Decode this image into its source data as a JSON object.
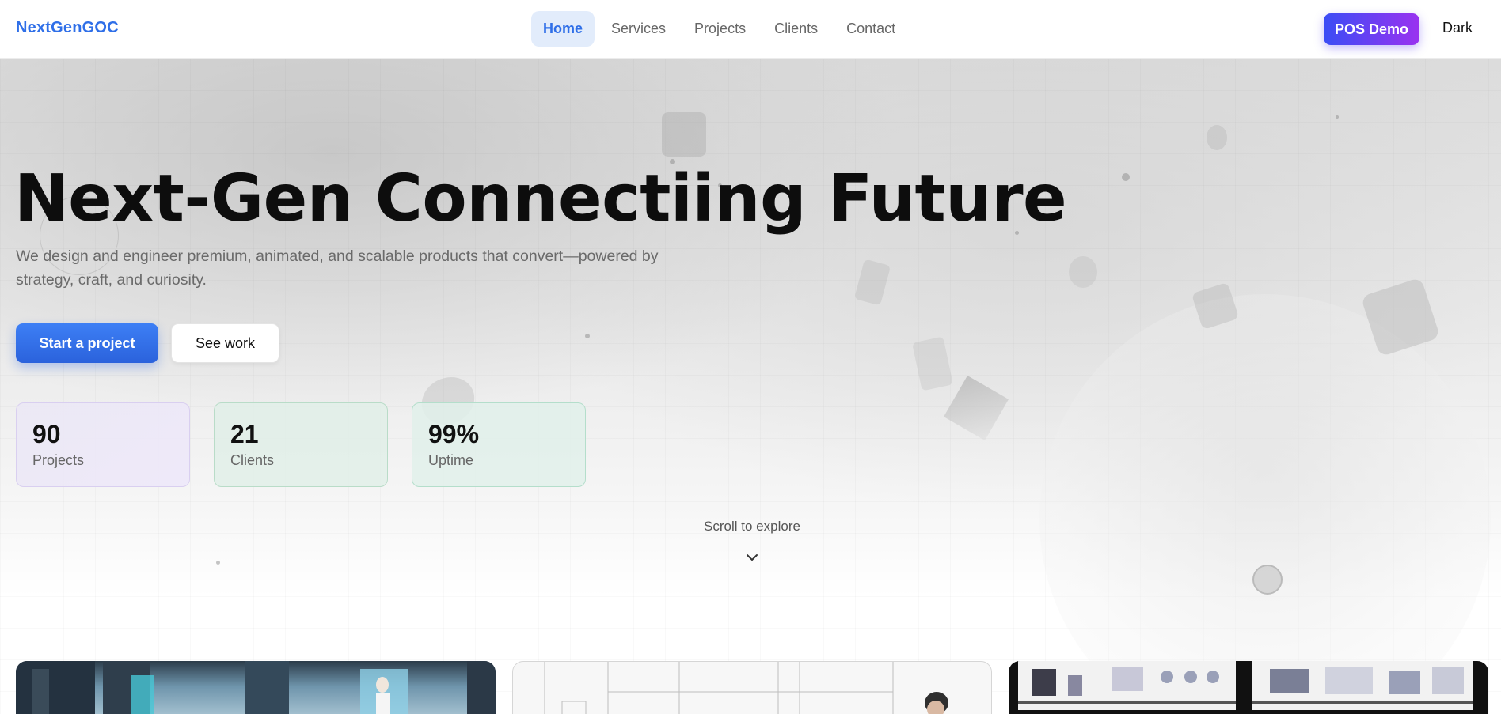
{
  "header": {
    "logo": "NextGenGOC",
    "nav": [
      {
        "label": "Home",
        "active": true
      },
      {
        "label": "Services",
        "active": false
      },
      {
        "label": "Projects",
        "active": false
      },
      {
        "label": "Clients",
        "active": false
      },
      {
        "label": "Contact",
        "active": false
      }
    ],
    "pos_demo_label": "POS Demo",
    "theme_toggle_label": "Dark"
  },
  "hero": {
    "title": "Next-Gen Connectiing Future",
    "subtitle": "We design and engineer premium, animated, and scalable products that convert—powered by strategy, craft, and curiosity.",
    "primary_cta": "Start a project",
    "secondary_cta": "See work"
  },
  "stats": [
    {
      "value": "90",
      "label": "Projects"
    },
    {
      "value": "21",
      "label": "Clients"
    },
    {
      "value": "99%",
      "label": "Uptime"
    }
  ],
  "scroll_hint": "Scroll to explore",
  "colors": {
    "brand_blue": "#2f6fe8",
    "pos_gradient_start": "#3b4df5",
    "pos_gradient_end": "#9a32f0",
    "primary_button": "#2b62dc",
    "text_dark": "#0d0d0d"
  },
  "icons": {
    "scroll": "chevron-down-icon"
  }
}
